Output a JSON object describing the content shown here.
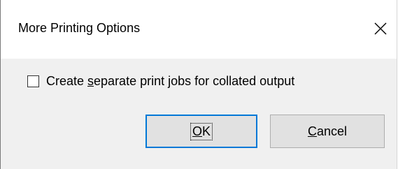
{
  "dialog": {
    "title": "More Printing Options",
    "close_icon": "close-icon"
  },
  "option": {
    "checked": false,
    "label_pre": "Create ",
    "label_accel": "s",
    "label_post": "eparate print jobs for collated output"
  },
  "buttons": {
    "ok_accel": "O",
    "ok_rest": "K",
    "cancel_accel": "C",
    "cancel_rest": "ancel"
  },
  "colors": {
    "dialog_background": "#f0f0f0",
    "titlebar_background": "#ffffff",
    "default_button_border": "#0078d7",
    "button_background": "#e1e1e1"
  }
}
